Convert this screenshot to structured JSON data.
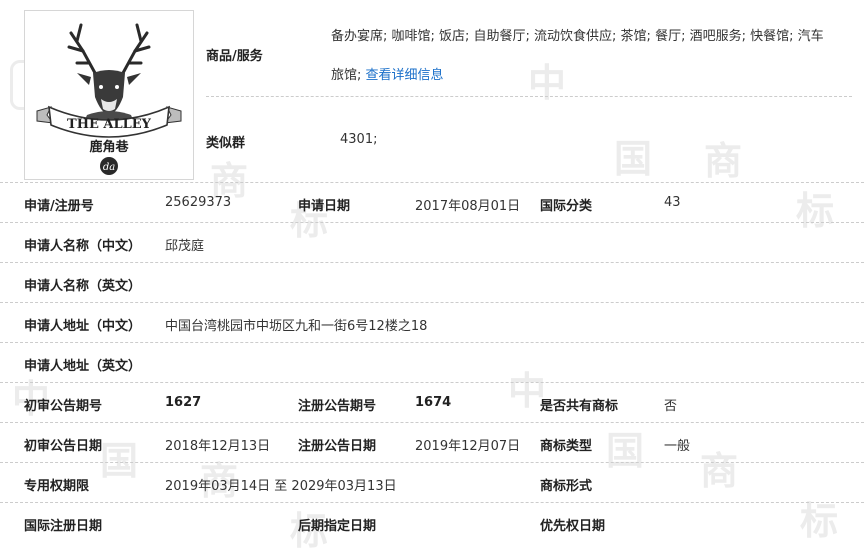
{
  "logo": {
    "brand_text": "THE ALLEY",
    "chinese_text": "鹿角巷",
    "monogram": "da"
  },
  "goods": {
    "label": "商品/服务",
    "text_line1": "备办宴席; 咖啡馆; 饭店; 自助餐厅; 流动饮食供应; 茶馆; 餐厅; 酒吧服务; 快餐馆; 汽车",
    "text_line2": "旅馆;",
    "more_link": "查看详细信息"
  },
  "similar_group": {
    "label": "类似群",
    "value": "4301;"
  },
  "rows": [
    {
      "c1l": "申请/注册号",
      "c1v": "25629373",
      "c2l": "申请日期",
      "c2v": "2017年08月01日",
      "c3l": "国际分类",
      "c3v": "43"
    },
    {
      "c1l": "申请人名称（中文）",
      "c1v": "邱茂庭"
    },
    {
      "c1l": "申请人名称（英文）",
      "c1v": ""
    },
    {
      "c1l": "申请人地址（中文）",
      "c1v": "中国台湾桃园市中坜区九和一街6号12楼之18"
    },
    {
      "c1l": "申请人地址（英文）",
      "c1v": ""
    },
    {
      "c1l": "初审公告期号",
      "c1v": "1627",
      "c2l": "注册公告期号",
      "c2v": "1674",
      "c3l": "是否共有商标",
      "c3v": "否"
    },
    {
      "c1l": "初审公告日期",
      "c1v": "2018年12月13日",
      "c2l": "注册公告日期",
      "c2v": "2019年12月07日",
      "c3l": "商标类型",
      "c3v": "一般"
    },
    {
      "c1l": "专用权期限",
      "c1v": "2019年03月14日 至 2029年03月13日",
      "c3l": "商标形式",
      "c3v": ""
    },
    {
      "c1l": "国际注册日期",
      "c1v": "",
      "c2l": "后期指定日期",
      "c2v": "",
      "c3l": "优先权日期",
      "c3v": ""
    }
  ],
  "watermark": {
    "chars": [
      "中",
      "国",
      "商",
      "标"
    ]
  }
}
